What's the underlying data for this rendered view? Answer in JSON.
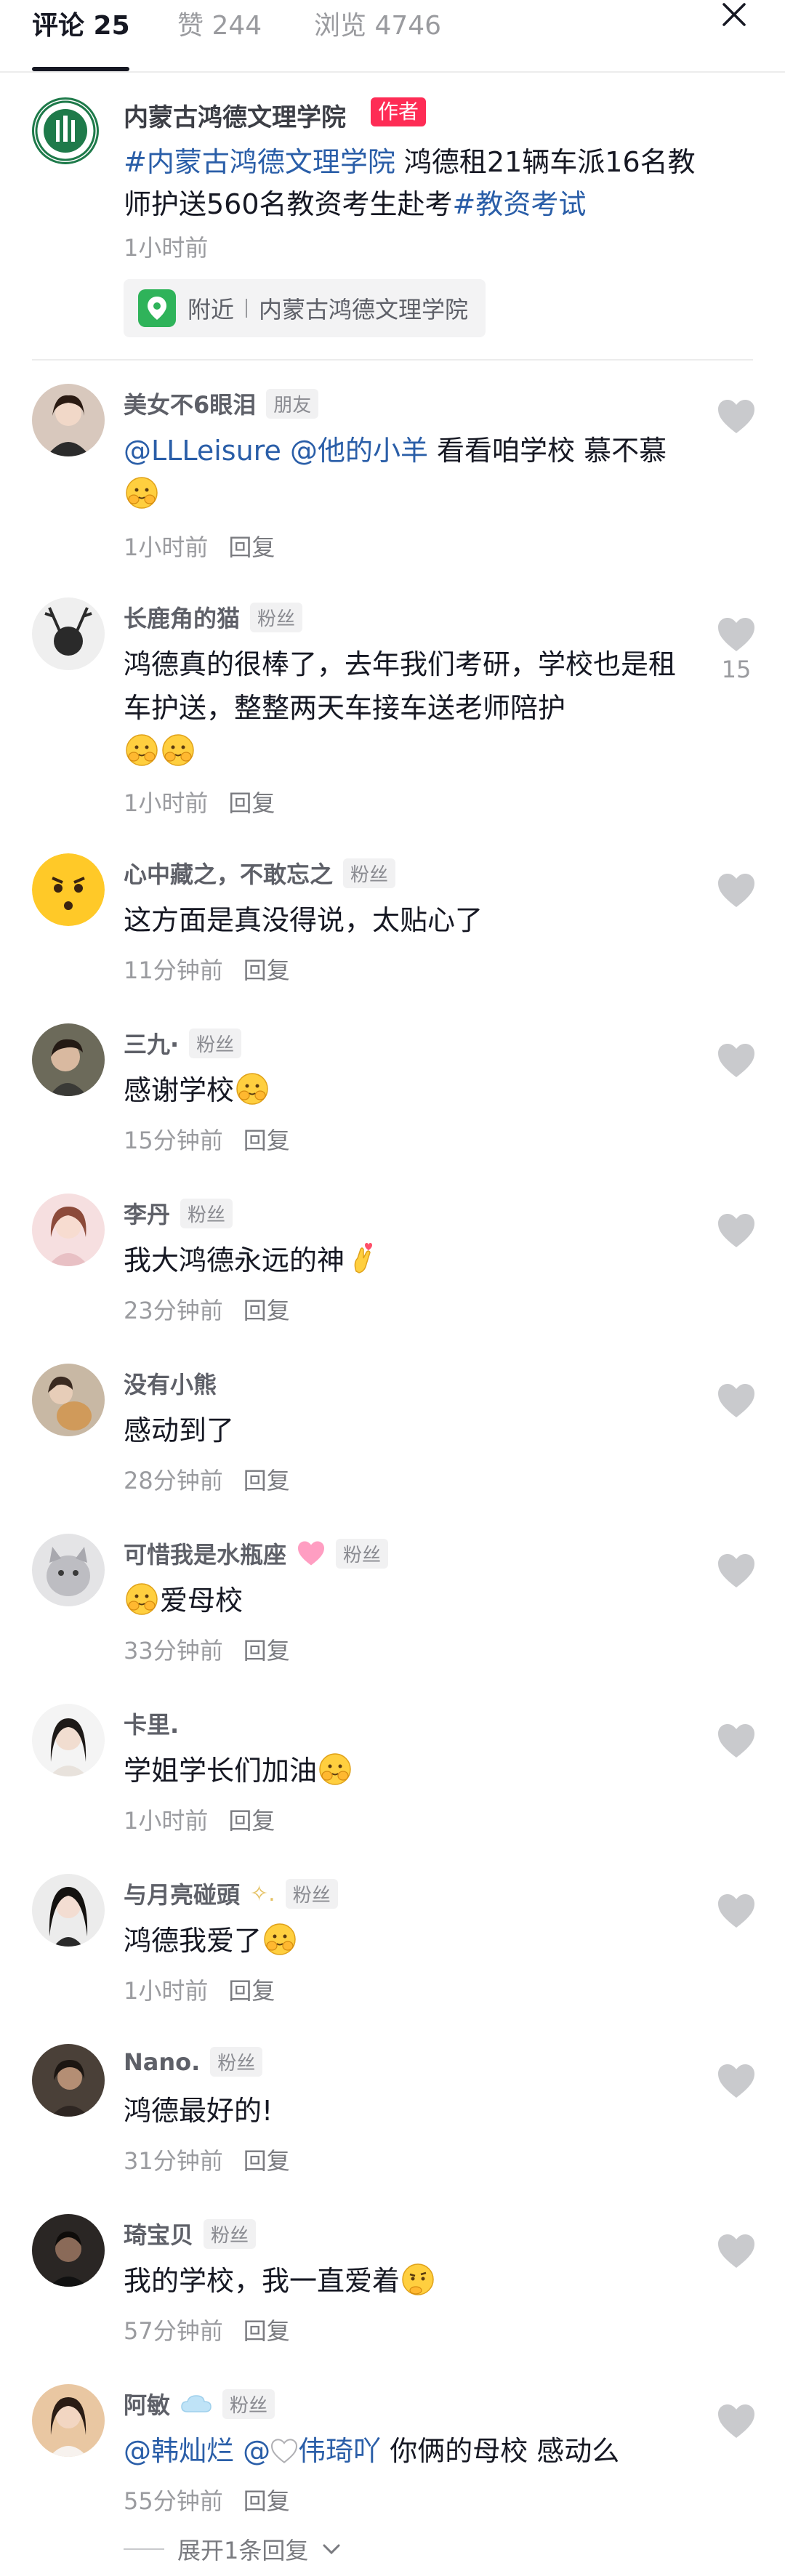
{
  "header": {
    "tabs": [
      {
        "label": "评论 25"
      },
      {
        "label": "赞 244"
      },
      {
        "label": "浏览 4746"
      }
    ]
  },
  "post": {
    "author_name": "内蒙古鸿德文理学院",
    "author_badge": "作者",
    "hashtag_1": "#内蒙古鸿德文理学院",
    "text_middle": " 鸿德租21辆车派16名教师护送560名教资考生赴考",
    "hashtag_2": "#教资考试",
    "time": "1小时前",
    "location_prefix": "附近",
    "location_name": "内蒙古鸿德文理学院"
  },
  "reply_label": "回复",
  "comments": [
    {
      "name": "美女不6眼泪",
      "tag": "朋友",
      "mention_1": "@LLLeisure",
      "mention_2": "@他的小羊",
      "text": " 看看咱学校 慕不慕",
      "time": "1小时前",
      "likes": ""
    },
    {
      "name": "长鹿角的猫",
      "tag": "粉丝",
      "text": "鸿德真的很棒了，去年我们考研，学校也是租车护送，整整两天车接车送老师陪护",
      "time": "1小时前",
      "likes": "15"
    },
    {
      "name": "心中藏之，不敢忘之",
      "tag": "粉丝",
      "text": "这方面是真没得说，太贴心了",
      "time": "11分钟前",
      "likes": ""
    },
    {
      "name": "三九·",
      "tag": "粉丝",
      "text": "感谢学校",
      "time": "15分钟前",
      "likes": ""
    },
    {
      "name": "李丹",
      "tag": "粉丝",
      "text": "我大鸿德永远的神",
      "time": "23分钟前",
      "likes": ""
    },
    {
      "name": "没有小熊",
      "tag": "",
      "text": "感动到了",
      "time": "28分钟前",
      "likes": ""
    },
    {
      "name": "可惜我是水瓶座",
      "tag": "粉丝",
      "text": "爱母校",
      "time": "33分钟前",
      "likes": ""
    },
    {
      "name": "卡里.",
      "tag": "",
      "text": "学姐学长们加油",
      "time": "1小时前",
      "likes": ""
    },
    {
      "name": "与月亮碰頭",
      "tag": "粉丝",
      "text": "鸿德我爱了",
      "time": "1小时前",
      "likes": ""
    },
    {
      "name": "Nano.",
      "tag": "粉丝",
      "text": "鸿德最好的!",
      "time": "31分钟前",
      "likes": ""
    },
    {
      "name": "琦宝贝",
      "tag": "粉丝",
      "text": "我的学校，我一直爱着",
      "time": "57分钟前",
      "likes": ""
    },
    {
      "name": "阿敏",
      "tag": "粉丝",
      "mention_1": "@韩灿烂",
      "mention_2": "伟琦吖",
      "text": " 你俩的母校 感动么",
      "time": "55分钟前",
      "likes": ""
    }
  ],
  "expand_label": "展开1条回复",
  "colors": {
    "accent_red": "#fe2c55",
    "link_blue": "#2a5ea8",
    "location_green": "#2fb35a"
  },
  "icons": [
    "close-icon",
    "heart-icon",
    "location-pin-icon",
    "chevron-down-icon"
  ]
}
